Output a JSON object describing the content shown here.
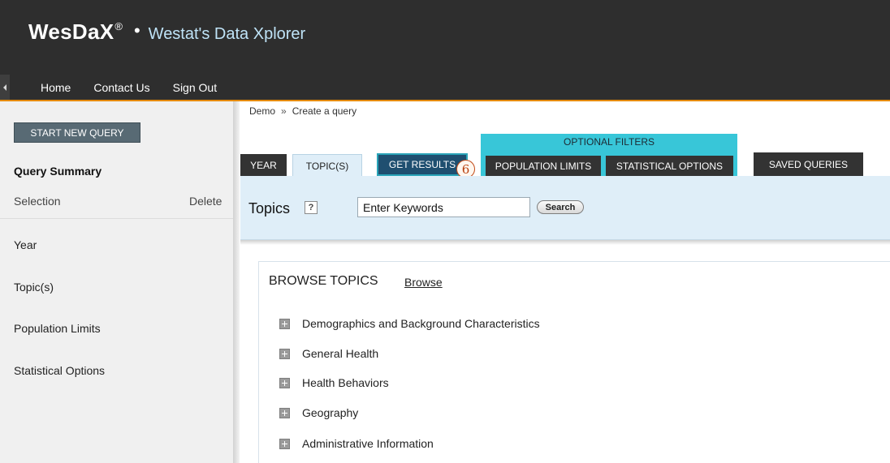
{
  "header": {
    "brand_name": "WesDaX",
    "brand_mark": "®",
    "brand_bullet": "•",
    "brand_subtitle": "Westat's Data Xplorer",
    "nav": [
      "Home",
      "Contact Us",
      "Sign Out"
    ]
  },
  "sidebar": {
    "start_button": "START NEW QUERY",
    "summary_title": "Query Summary",
    "selection_label": "Selection",
    "delete_label": "Delete",
    "items": [
      "Year",
      "Topic(s)",
      "Population Limits",
      "Statistical Options"
    ]
  },
  "breadcrumb": {
    "root": "Demo",
    "separator": "»",
    "current": "Create a query"
  },
  "tabs": {
    "year": "YEAR",
    "topics": "TOPIC(S)",
    "get_results": "GET RESULTS",
    "optional_filters": "OPTIONAL FILTERS",
    "population_limits": "POPULATION LIMITS",
    "statistical_options": "STATISTICAL OPTIONS",
    "saved_queries": "SAVED QUERIES",
    "step_badge": "6"
  },
  "topics_panel": {
    "title": "Topics",
    "help": "?",
    "keyword_value": "Enter Keywords",
    "search_label": "Search"
  },
  "browse": {
    "title": "BROWSE TOPICS",
    "link": "Browse",
    "items": [
      "Demographics and Background Characteristics",
      "General Health",
      "Health Behaviors",
      "Geography",
      "Administrative Information"
    ]
  },
  "colors": {
    "header_bg": "#2e2e2e",
    "accent_orange": "#f08c00",
    "optional_filter_teal": "#38c6d8",
    "panel_blue": "#dfeef8",
    "get_results_blue": "#1f4f70"
  }
}
